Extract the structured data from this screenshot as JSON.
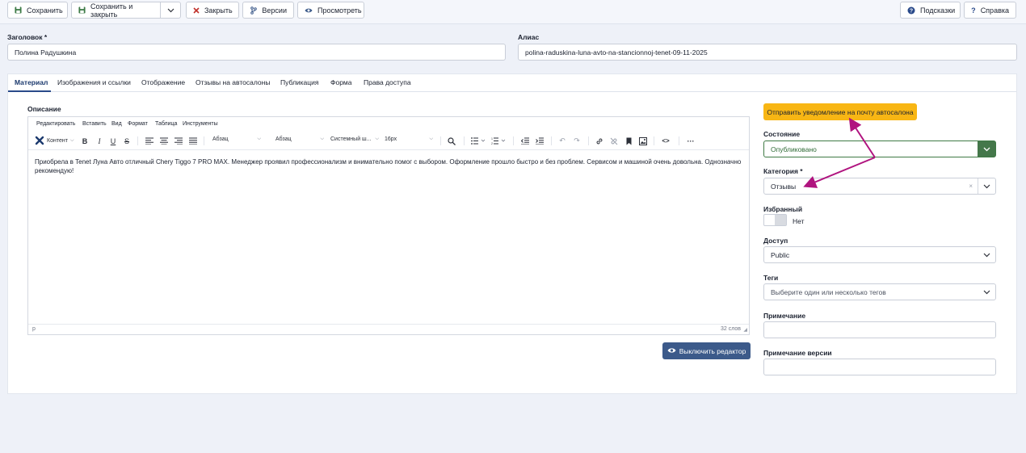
{
  "toolbar": {
    "save": "Сохранить",
    "save_close": "Сохранить и закрыть",
    "close": "Закрыть",
    "versions": "Версии",
    "preview": "Просмотреть",
    "hints": "Подсказки",
    "help": "Справка"
  },
  "fields": {
    "title_label": "Заголовок *",
    "title_value": "Полина Радушкина",
    "alias_label": "Алиас",
    "alias_value": "polina-raduskina-luna-avto-na-stancionnoj-tenet-09-11-2025"
  },
  "tabs": [
    "Материал",
    "Изображения и ссылки",
    "Отображение",
    "Отзывы на автосалоны",
    "Публикация",
    "Форма",
    "Права доступа"
  ],
  "editor": {
    "label": "Описание",
    "menu": [
      "Редактировать",
      "Вставить",
      "Вид",
      "Формат",
      "Таблица",
      "Инструменты"
    ],
    "content_btn": "Контент",
    "block1": "Абзац",
    "block2": "Абзац",
    "font": "Системный ш...",
    "size": "16px",
    "text": "Приобрела в Tenet Луна Авто отличный Chery Tiggo 7 PRO MAX. Менеджер проявил профессионализм и внимательно помог с выбором. Оформление прошло быстро и без проблем. Сервисом и машиной очень довольна. Однозначно рекомендую!",
    "path": "p",
    "words": "32 слов",
    "toggle_button": "Выключить редактор"
  },
  "sidebar": {
    "notify_button": "Отправить уведомление на почту автосалона",
    "state_label": "Состояние",
    "state_value": "Опубликовано",
    "category_label": "Категория *",
    "category_value": "Отзывы",
    "featured_label": "Избранный",
    "featured_value": "Нет",
    "access_label": "Доступ",
    "access_value": "Public",
    "tags_label": "Теги",
    "tags_placeholder": "Выберите один или несколько тегов",
    "note_label": "Примечание",
    "note_value": "",
    "version_note_label": "Примечание версии",
    "version_note_value": ""
  },
  "colors": {
    "notify_button_bg": "#f8b614",
    "state_border": "#3f7a45",
    "state_arrow_bg": "#44774a",
    "editor_toggle_bg": "#3c5a8a",
    "annotation_arrow": "#b0147f"
  }
}
